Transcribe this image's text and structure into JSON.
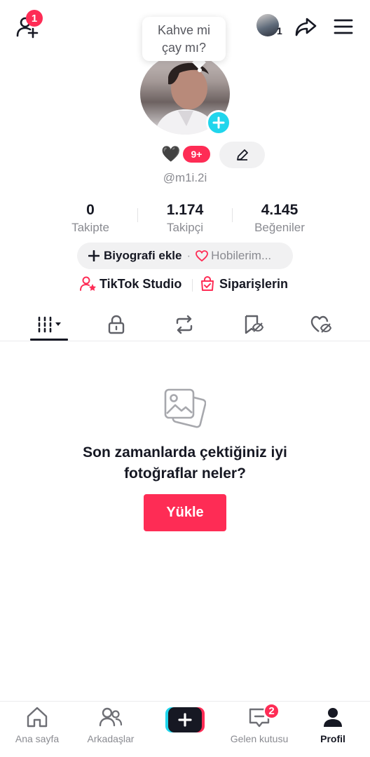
{
  "header": {
    "add_friends_badge": "1",
    "account_switch_count": "1"
  },
  "profile": {
    "bubble_line1": "Kahve mi",
    "bubble_line2": "çay mı?",
    "heart": "🖤",
    "badge_count": "9+",
    "username": "@m1i.2i"
  },
  "stats": [
    {
      "value": "0",
      "label": "Takipte"
    },
    {
      "value": "1.174",
      "label": "Takipçi"
    },
    {
      "value": "4.145",
      "label": "Beğeniler"
    }
  ],
  "bio": {
    "add_bio": "Biyografi ekle",
    "separator": "·",
    "hobbies": "Hobilerim..."
  },
  "links": {
    "studio": "TikTok Studio",
    "orders": "Siparişlerin"
  },
  "empty_state": {
    "line1": "Son zamanlarda çektiğiniz iyi",
    "line2": "fotoğraflar neler?",
    "button": "Yükle"
  },
  "bottom_nav": {
    "home": "Ana sayfa",
    "friends": "Arkadaşlar",
    "inbox": "Gelen kutusu",
    "inbox_badge": "2",
    "profile": "Profil"
  },
  "colors": {
    "accent": "#fe2c55",
    "cyan": "#20d5ec",
    "text": "#161823",
    "muted": "#8a8b91"
  }
}
